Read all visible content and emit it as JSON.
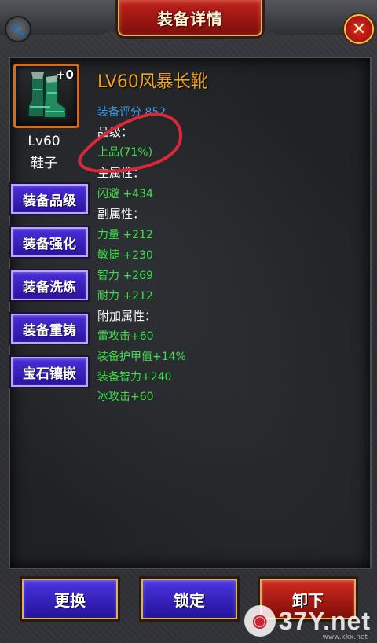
{
  "header": {
    "title": "装备详情"
  },
  "item": {
    "enhance": "+0",
    "level": "Lv60",
    "type": "鞋子",
    "name": "LV60风暴长靴",
    "score": "装备评分 852",
    "grade_label": "品级：",
    "grade_value": "上品(71%)",
    "main_attr_label": "主属性：",
    "main_attrs": [
      "闪避 +434"
    ],
    "sub_attr_label": "副属性：",
    "sub_attrs": [
      "力量 +212",
      "敏捷 +230",
      "智力 +269",
      "耐力 +212"
    ],
    "extra_attr_label": "附加属性：",
    "extra_attrs": [
      "雷攻击+60",
      "装备护甲值+14%",
      "装备智力+240",
      "冰攻击+60"
    ]
  },
  "side_buttons": [
    "装备品级",
    "装备强化",
    "装备洗炼",
    "装备重铸",
    "宝石镶嵌"
  ],
  "bottom_buttons": {
    "replace": "更换",
    "lock": "锁定",
    "unequip": "卸下"
  },
  "watermark": {
    "text": "37Y.net",
    "small": "www.kkx.net"
  },
  "colors": {
    "name": "#f0a020",
    "score": "#3d9bea",
    "stat": "#3ce04a",
    "annotation": "#d8283a"
  },
  "icons": {
    "pet": "paw-icon",
    "close": "close-icon",
    "item": "boots-icon"
  }
}
